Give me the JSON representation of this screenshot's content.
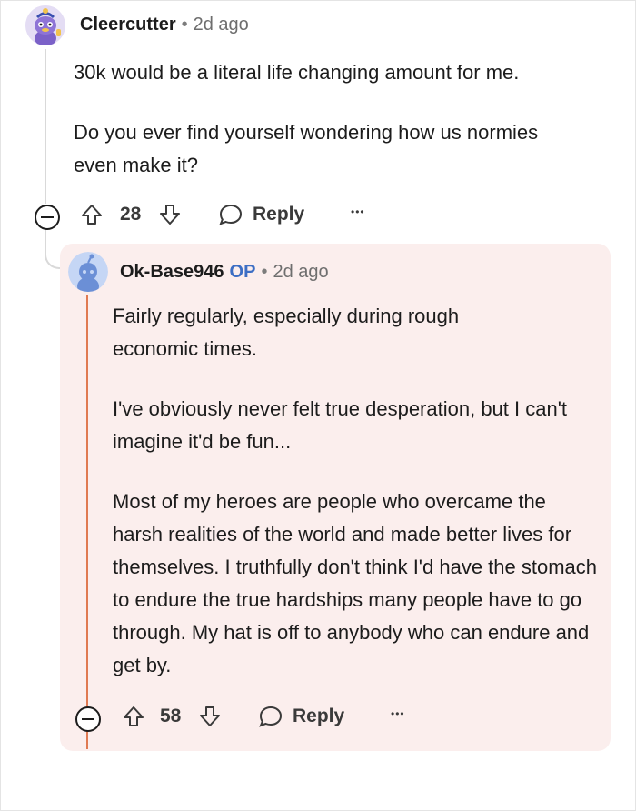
{
  "comment": {
    "username": "Cleercutter",
    "separator": "•",
    "time": "2d ago",
    "paragraphs": [
      "30k would be a literal life changing amount for me.",
      "Do you ever find yourself wondering how us normies even make it?"
    ],
    "vote_count": "28",
    "reply_label": "Reply",
    "more_label": "•••"
  },
  "reply": {
    "username": "Ok-Base946",
    "op_label": "OP",
    "separator": "•",
    "time": "2d ago",
    "paragraphs": [
      "Fairly regularly, especially during rough economic times.",
      "I've obviously never felt true desperation, but I can't imagine it'd be fun...",
      "Most of my heroes are people who overcame the harsh realities of the world and made better lives for themselves. I truthfully don't think I'd have the stomach to endure the true hardships many people have to go through. My hat is off to anybody who can endure and get by."
    ],
    "vote_count": "58",
    "reply_label": "Reply",
    "more_label": "•••"
  },
  "colors": {
    "highlight_background": "#fbeeed",
    "op_accent": "#3c6ec4",
    "thread_line": "#d9d9d9",
    "highlight_line": "#e07a52"
  }
}
